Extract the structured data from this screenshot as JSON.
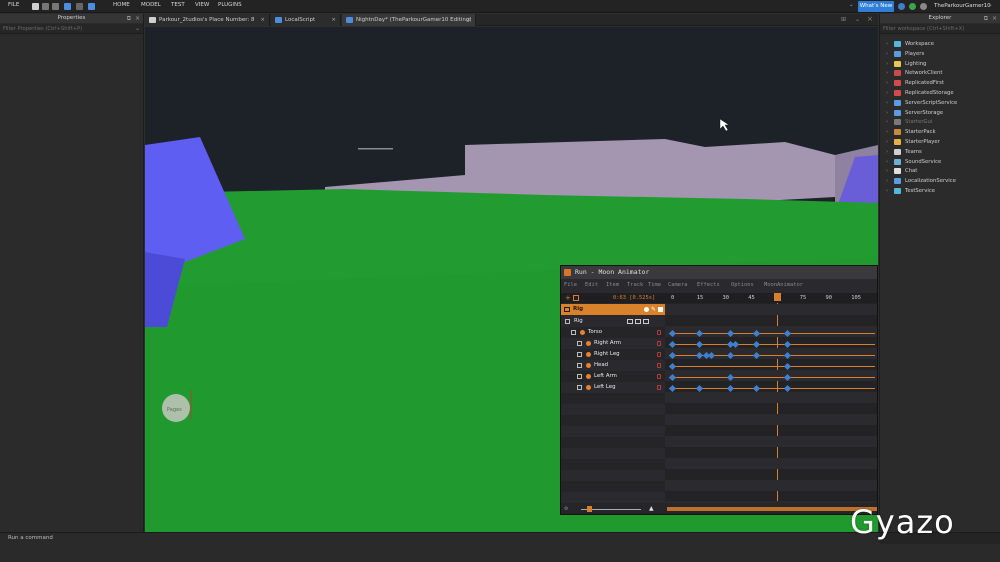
{
  "topbar": {
    "file": "FILE",
    "menu": [
      "HOME",
      "MODEL",
      "TEST",
      "VIEW",
      "PLUGINS"
    ],
    "whats_new": "What's New",
    "username": "TheParkourGamer10"
  },
  "properties": {
    "title": "Properties",
    "filter": "Filter Properties (Ctrl+Shift+P)"
  },
  "tabs": [
    {
      "label": "Parkour_2tudios's Place Number: 8",
      "icon": "cloud-icon",
      "active": false
    },
    {
      "label": "LocalScript",
      "icon": "script-icon",
      "active": false
    },
    {
      "label": "NightnDay* (TheParkourGamer10 Editing)",
      "icon": "script-icon",
      "active": true
    }
  ],
  "viewport": {
    "billboard_label": "Pages",
    "colors": {
      "sky": "#1c2228",
      "grass": "#23a332",
      "wall": "#9b8ea8",
      "character": "#5b5bf0"
    }
  },
  "explorer": {
    "title": "Explorer",
    "filter": "Filter workspace (Ctrl+Shift+X)",
    "items": [
      {
        "label": "Workspace",
        "icon": "globe-icon",
        "color": "#52b7d8"
      },
      {
        "label": "Players",
        "icon": "players-icon",
        "color": "#5b9be0"
      },
      {
        "label": "Lighting",
        "icon": "lightbulb-icon",
        "color": "#e6c84a"
      },
      {
        "label": "NetworkClient",
        "icon": "network-icon",
        "color": "#c94b4b"
      },
      {
        "label": "ReplicatedFirst",
        "icon": "replicated-icon",
        "color": "#d44a4a"
      },
      {
        "label": "ReplicatedStorage",
        "icon": "storage-icon",
        "color": "#d44a4a"
      },
      {
        "label": "ServerScriptService",
        "icon": "script-service-icon",
        "color": "#5b9be0"
      },
      {
        "label": "ServerStorage",
        "icon": "server-storage-icon",
        "color": "#5b9be0"
      },
      {
        "label": "StarterGui",
        "icon": "gui-icon",
        "color": "#7a7a7a"
      },
      {
        "label": "StarterPack",
        "icon": "backpack-icon",
        "color": "#c98b3a"
      },
      {
        "label": "StarterPlayer",
        "icon": "folder-icon",
        "color": "#e3b04a"
      },
      {
        "label": "Teams",
        "icon": "teams-icon",
        "color": "#d0d0d0"
      },
      {
        "label": "SoundService",
        "icon": "speaker-icon",
        "color": "#6cb0d6"
      },
      {
        "label": "Chat",
        "icon": "chat-icon",
        "color": "#e0e0e0"
      },
      {
        "label": "LocalizationService",
        "icon": "globe-icon",
        "color": "#5b9be0"
      },
      {
        "label": "TestService",
        "icon": "check-icon",
        "color": "#52b7d8"
      }
    ]
  },
  "moon": {
    "title": "Run - Moon Animator",
    "menu": [
      "File",
      "Edit",
      "Item",
      "Track",
      "Time",
      "Camera",
      "Effects",
      "Options",
      "MoonAnimator"
    ],
    "time_readout": "0:63 [0.525s]",
    "ticks": [
      "0",
      "15",
      "30",
      "45",
      "60",
      "75",
      "90",
      "105"
    ],
    "rig_label": "Rig",
    "tracks": [
      {
        "label": "Rig",
        "indent": 0,
        "dot": false,
        "keyframes": []
      },
      {
        "label": "Torso",
        "indent": 1,
        "dot": true,
        "keyframes": [
          2,
          18,
          36,
          51,
          69
        ]
      },
      {
        "label": "Right Arm",
        "indent": 2,
        "dot": true,
        "keyframes": [
          2,
          18,
          36,
          39,
          51,
          69
        ]
      },
      {
        "label": "Right Leg",
        "indent": 2,
        "dot": true,
        "keyframes": [
          2,
          18,
          22,
          25,
          36,
          51,
          69
        ]
      },
      {
        "label": "Head",
        "indent": 2,
        "dot": true,
        "keyframes": [
          2,
          69
        ]
      },
      {
        "label": "Left Arm",
        "indent": 2,
        "dot": true,
        "keyframes": [
          2,
          36,
          69
        ]
      },
      {
        "label": "Left Leg",
        "indent": 2,
        "dot": true,
        "keyframes": [
          2,
          18,
          36,
          51,
          69
        ]
      }
    ],
    "playhead_frame": 63
  },
  "status": {
    "command_placeholder": "Run a command"
  },
  "watermark": "Gyazo"
}
